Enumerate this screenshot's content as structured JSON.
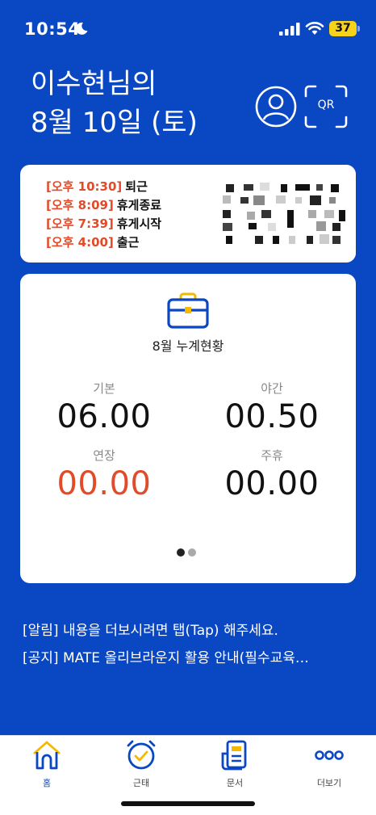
{
  "status_bar": {
    "time": "10:54",
    "battery": "37"
  },
  "greeting": {
    "line1": "이수현님의",
    "line2": "8월 10일 (토)"
  },
  "qr_label": "QR",
  "time_log": [
    {
      "time": "[오후 10:30]",
      "label": "퇴근"
    },
    {
      "time": "[오후 8:09]",
      "label": "휴게종료"
    },
    {
      "time": "[오후 7:39]",
      "label": "휴게시작"
    },
    {
      "time": "[오후 4:00]",
      "label": "출근"
    }
  ],
  "stats_card": {
    "title": "8월 누계현황",
    "items": [
      {
        "label": "기본",
        "value": "06.00"
      },
      {
        "label": "야간",
        "value": "00.50"
      },
      {
        "label": "연장",
        "value": "00.00"
      },
      {
        "label": "주휴",
        "value": "00.00"
      }
    ],
    "page_count": 2,
    "active_page": 1
  },
  "notices": [
    "[알림] 내용을 더보시려면 탭(Tap) 해주세요.",
    "[공지] MATE 올리브라운지 활용 안내(필수교육…"
  ],
  "nav": [
    {
      "label": "홈",
      "icon": "home-icon",
      "active": true
    },
    {
      "label": "근태",
      "icon": "alarm-clock-icon",
      "active": false
    },
    {
      "label": "문서",
      "icon": "document-icon",
      "active": false
    },
    {
      "label": "더보기",
      "icon": "more-icon",
      "active": false
    }
  ],
  "colors": {
    "primary_blue": "#0a47c2",
    "accent_red": "#e24b2a",
    "accent_yellow": "#f5b800"
  }
}
